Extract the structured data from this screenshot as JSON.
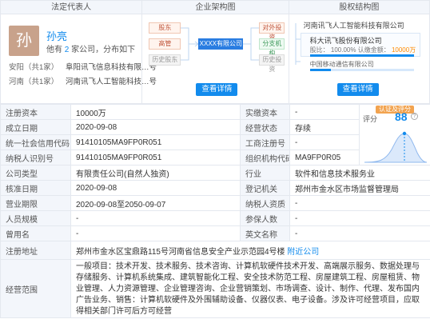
{
  "legal_rep": {
    "title": "法定代表人",
    "avatar_char": "孙",
    "name": "孙亮",
    "sub_prefix": "他有",
    "sub_count": "2",
    "sub_suffix": "家公司，分布如下",
    "companies": [
      {
        "tag": "安阳（共1家）",
        "name": "阜阳讯飞信息科技有限…号"
      },
      {
        "tag": "河南（共1家）",
        "name": "河南讯飞人工智能科技…号"
      }
    ]
  },
  "org_chart": {
    "title": "企业架构图",
    "nodes": {
      "left_top": "股东",
      "left_mid": "高管",
      "left_bot": "历史股东",
      "center": "XXXX有限公司",
      "right_top": "对外投资",
      "right_mid": "分支机构",
      "right_bot": "历史投资"
    },
    "button": "查看详情"
  },
  "equity_chart": {
    "title": "股权结构图",
    "root": "河南讯飞人工智能科技有限公司",
    "holders": [
      {
        "name": "科大讯飞股份有限公司",
        "label": "股比：",
        "pct": "100.00%",
        "amount_label": "认缴金额：",
        "amount": "10000万"
      },
      {
        "name": "中国移动通信有限公司",
        "label": "股比：",
        "pct": "",
        "amount_label": "",
        "amount": ""
      }
    ],
    "pct_fill": 1.0,
    "button": "查看详情"
  },
  "table": {
    "rows": [
      {
        "k1": "注册资本",
        "v1": "10000万",
        "k2": "实缴资本",
        "v2": "-"
      },
      {
        "k1": "成立日期",
        "v1": "2020-09-08",
        "k2": "经营状态",
        "v2": "存续"
      },
      {
        "k1": "统一社会信用代码",
        "v1": "91410105MA9FP0R051",
        "k2": "工商注册号",
        "v2": "-"
      },
      {
        "k1": "纳税人识别号",
        "v1": "91410105MA9FP0R051",
        "k2": "组织机构代码",
        "v2": "MA9FP0R05"
      },
      {
        "k1": "公司类型",
        "v1": "有限责任公司(自然人独资)",
        "k2": "行业",
        "v2": "软件和信息技术服务业"
      },
      {
        "k1": "核准日期",
        "v1": "2020-09-08",
        "k2": "登记机关",
        "v2": "郑州市金水区市场监督管理局"
      },
      {
        "k1": "营业期限",
        "v1": "2020-09-08至2050-09-07",
        "k2": "纳税人资质",
        "v2": "-"
      },
      {
        "k1": "人员规模",
        "v1": "-",
        "k2": "参保人数",
        "v2": "-"
      },
      {
        "k1": "曾用名",
        "v1": "-",
        "k2": "英文名称",
        "v2": "-"
      }
    ],
    "address_label": "注册地址",
    "address": "郑州市金水区宝鼎路115号河南省信息安全产业示范园4号楼",
    "address_link": "附近公司",
    "scope_label": "经营范围",
    "scope": "一般项目：技术开发、技术服务、技术咨询、计算机软硬件技术开发、高端展示服务、数据处理与存储服务、计算机系统集成、建筑智能化工程、安全技术防范工程、房屋建筑工程、房屋租赁、物业管理、人力资源管理、企业管理咨询、企业营销策划、市场调查、设计、制作、代理、发布国内广告业务、销售：计算机软硬件及外围辅助设备、仪器仪表、电子设备。涉及许可经营项目，应取得相关部门许可后方可经营"
  },
  "score": {
    "badge": "认证及评分",
    "label": "评分",
    "value": "88"
  }
}
